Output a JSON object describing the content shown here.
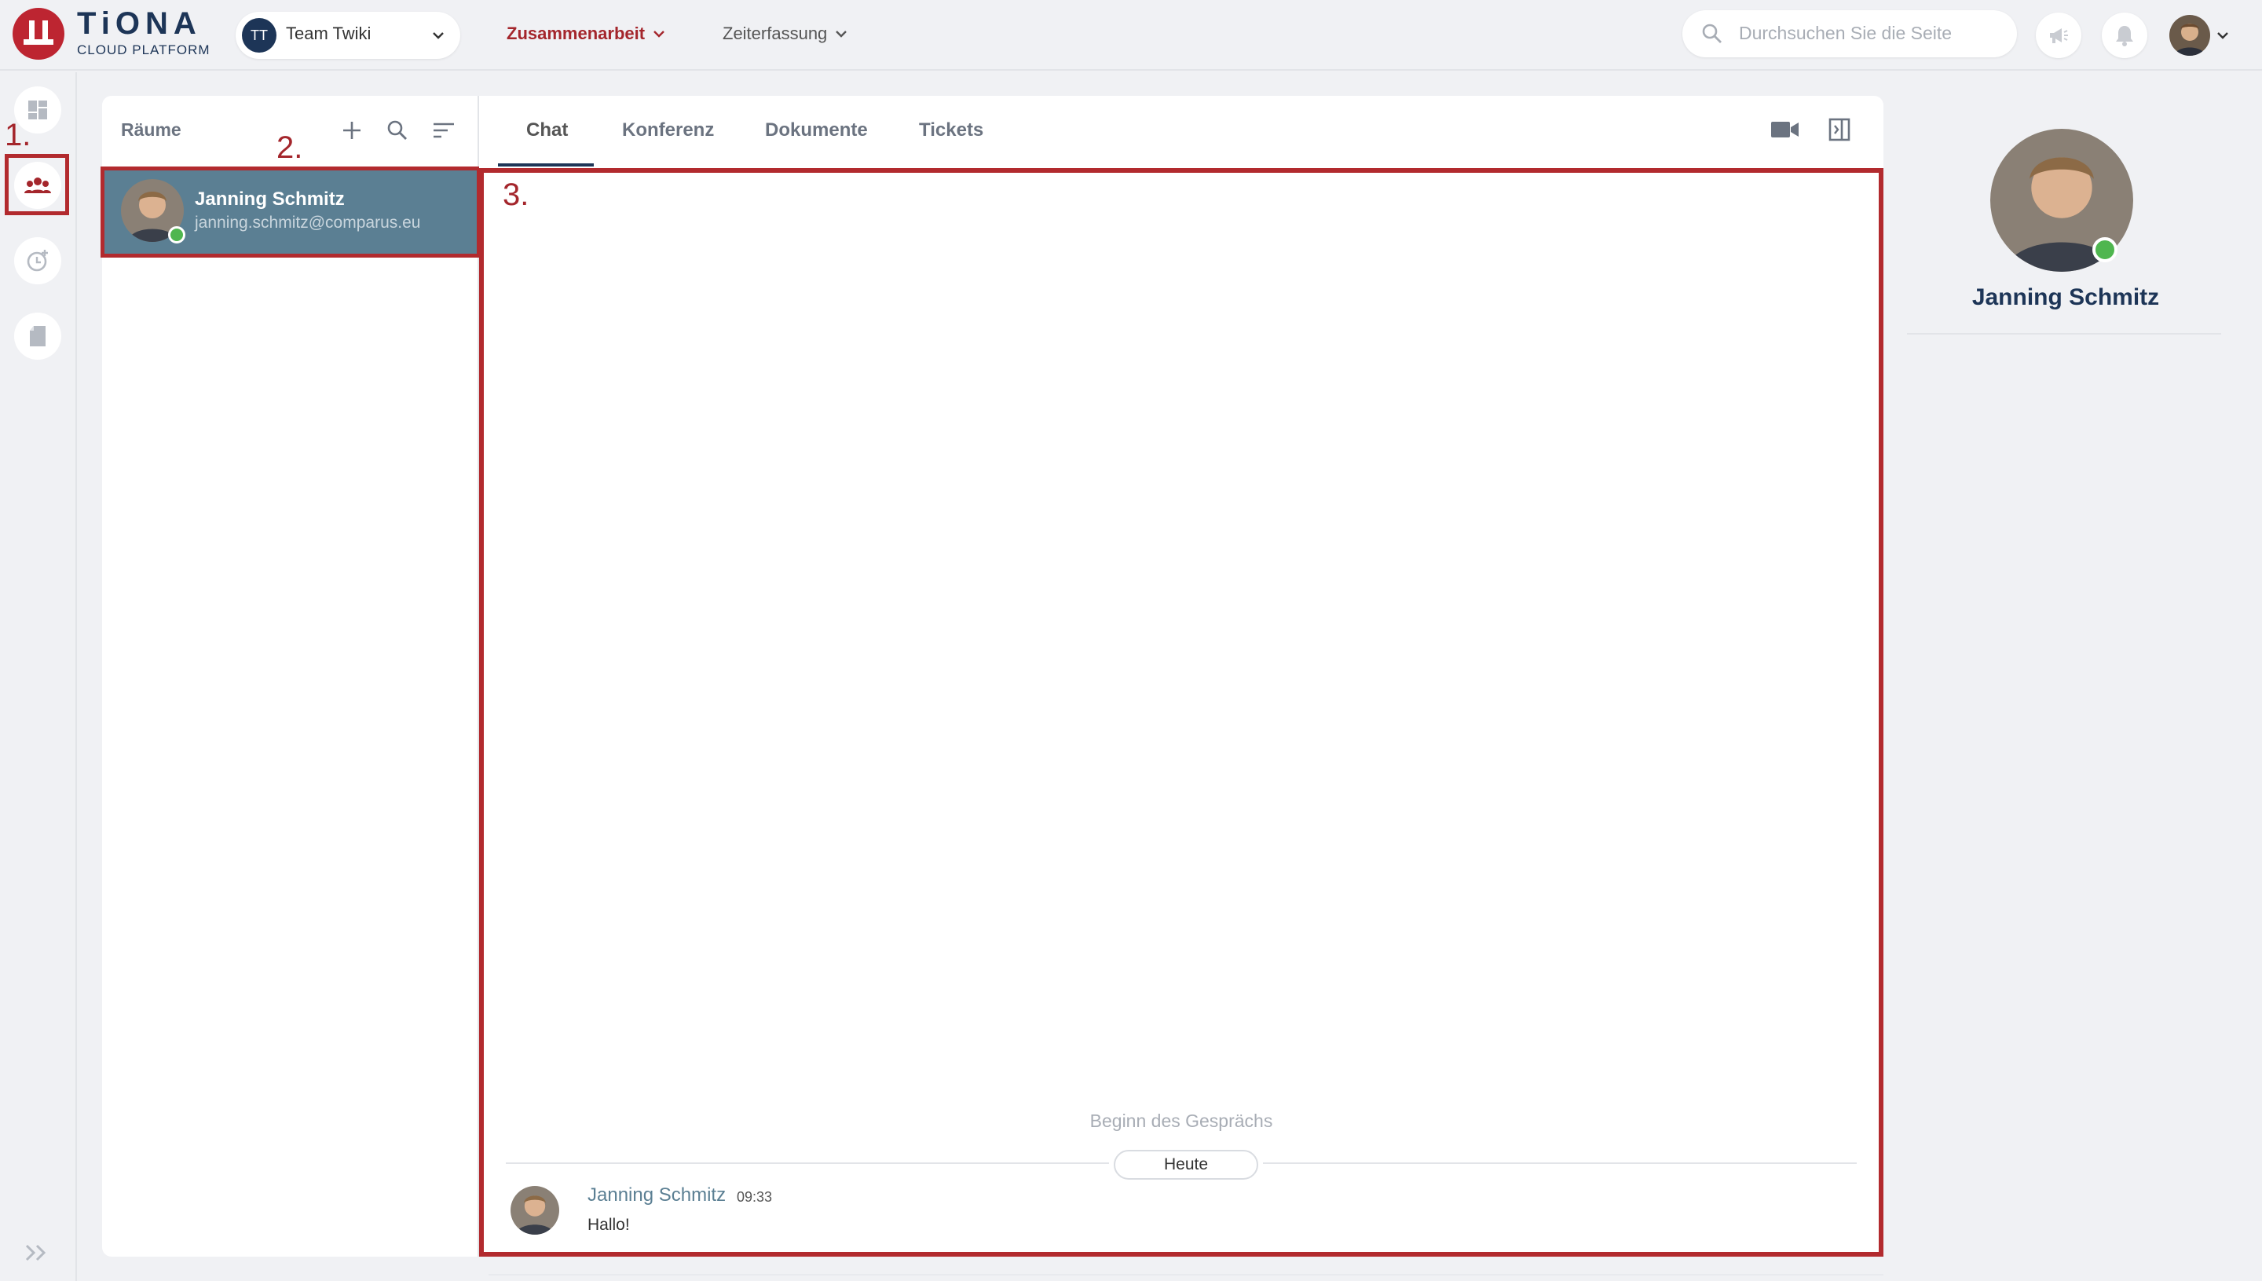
{
  "app": {
    "logo_title": "TiONA",
    "logo_subtitle": "CLOUD PLATFORM",
    "brand_color": "#bd2531",
    "accent_color": "#1d3557"
  },
  "team": {
    "initials": "TT",
    "name": "Team Twiki"
  },
  "nav": [
    {
      "label": "Zusammenarbeit",
      "active": true
    },
    {
      "label": "Zeiterfassung",
      "active": false
    }
  ],
  "search": {
    "placeholder": "Durchsuchen Sie die Seite"
  },
  "annotations": {
    "one": "1.",
    "two": "2.",
    "three": "3.",
    "color": "#b22a2e"
  },
  "rooms": {
    "title": "Räume",
    "items": [
      {
        "name": "Janning Schmitz",
        "email": "janning.schmitz@comparus.eu",
        "status": "online"
      }
    ]
  },
  "tabs": [
    {
      "label": "Chat",
      "active": true
    },
    {
      "label": "Konferenz",
      "active": false
    },
    {
      "label": "Dokumente",
      "active": false
    },
    {
      "label": "Tickets",
      "active": false
    }
  ],
  "chat": {
    "conversation_start": "Beginn des Gesprächs",
    "day_label": "Heute",
    "messages": [
      {
        "author": "Janning Schmitz",
        "time": "09:33",
        "text": "Hallo!"
      }
    ]
  },
  "profile": {
    "name": "Janning Schmitz",
    "status": "online"
  }
}
